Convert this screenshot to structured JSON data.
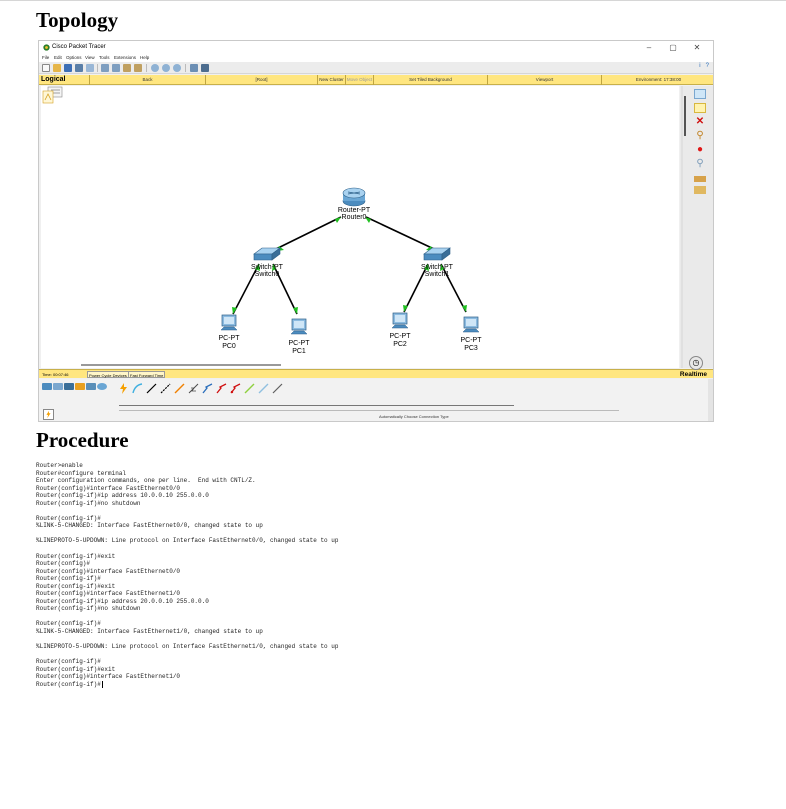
{
  "headings": {
    "topology": "Topology",
    "procedure": "Procedure"
  },
  "packet_tracer": {
    "window_title": "Cisco Packet Tracer",
    "window_controls": [
      "–",
      "▢",
      "✕"
    ],
    "menu": [
      "File",
      "Edit",
      "Options",
      "View",
      "Tools",
      "Extensions",
      "Help"
    ],
    "help_icons": [
      "i",
      "?"
    ],
    "logical_bar": {
      "mode": "Logical",
      "back": "Back",
      "root": "[Root]",
      "new_cluster": "New Cluster",
      "move_object": "Move Object",
      "set_tiled_background": "Set Tiled Background",
      "viewport": "Viewport",
      "environment": "Environment: 17:38:00"
    },
    "devices": [
      {
        "type": "Router-PT",
        "name": "Router0",
        "icon": "router-icon"
      },
      {
        "type": "Switch-PT",
        "name": "Switch0",
        "icon": "switch-icon"
      },
      {
        "type": "Switch-PT",
        "name": "Switch1",
        "icon": "switch-icon"
      },
      {
        "type": "PC-PT",
        "name": "PC0",
        "icon": "pc-icon"
      },
      {
        "type": "PC-PT",
        "name": "PC1",
        "icon": "pc-icon"
      },
      {
        "type": "PC-PT",
        "name": "PC2",
        "icon": "pc-icon"
      },
      {
        "type": "PC-PT",
        "name": "PC3",
        "icon": "pc-icon"
      }
    ],
    "links": [
      [
        "Router0",
        "Switch0"
      ],
      [
        "Router0",
        "Switch1"
      ],
      [
        "Switch0",
        "PC0"
      ],
      [
        "Switch0",
        "PC1"
      ],
      [
        "Switch1",
        "PC2"
      ],
      [
        "Switch1",
        "PC3"
      ]
    ],
    "status_bar": {
      "time": "Time: 00:07:46",
      "power_cycle": "Power Cycle Devices",
      "fast_forward": "Fast Forward Time",
      "mode": "Realtime"
    },
    "device_bar": {
      "auto_connection": "Automatically Choose Connection Type"
    },
    "colors": {
      "link": "#000000",
      "link_up": "#20c020",
      "bar_yellow": "#ffe680"
    }
  },
  "terminal_lines": [
    "Router>enable",
    "Router#configure terminal",
    "Enter configuration commands, one per line.  End with CNTL/Z.",
    "Router(config)#interface FastEthernet0/0",
    "Router(config-if)#ip address 10.0.0.10 255.0.0.0",
    "Router(config-if)#no shutdown",
    "",
    "Router(config-if)#",
    "%LINK-5-CHANGED: Interface FastEthernet0/0, changed state to up",
    "",
    "%LINEPROTO-5-UPDOWN: Line protocol on Interface FastEthernet0/0, changed state to up",
    "",
    "Router(config-if)#exit",
    "Router(config)#",
    "Router(config)#interface FastEthernet0/0",
    "Router(config-if)#",
    "Router(config-if)#exit",
    "Router(config)#interface FastEthernet1/0",
    "Router(config-if)#ip address 20.0.0.10 255.0.0.0",
    "Router(config-if)#no shutdown",
    "",
    "Router(config-if)#",
    "%LINK-5-CHANGED: Interface FastEthernet1/0, changed state to up",
    "",
    "%LINEPROTO-5-UPDOWN: Line protocol on Interface FastEthernet1/0, changed state to up",
    "",
    "Router(config-if)#",
    "Router(config-if)#exit",
    "Router(config)#interface FastEthernet1/0",
    "Router(config-if)#"
  ]
}
